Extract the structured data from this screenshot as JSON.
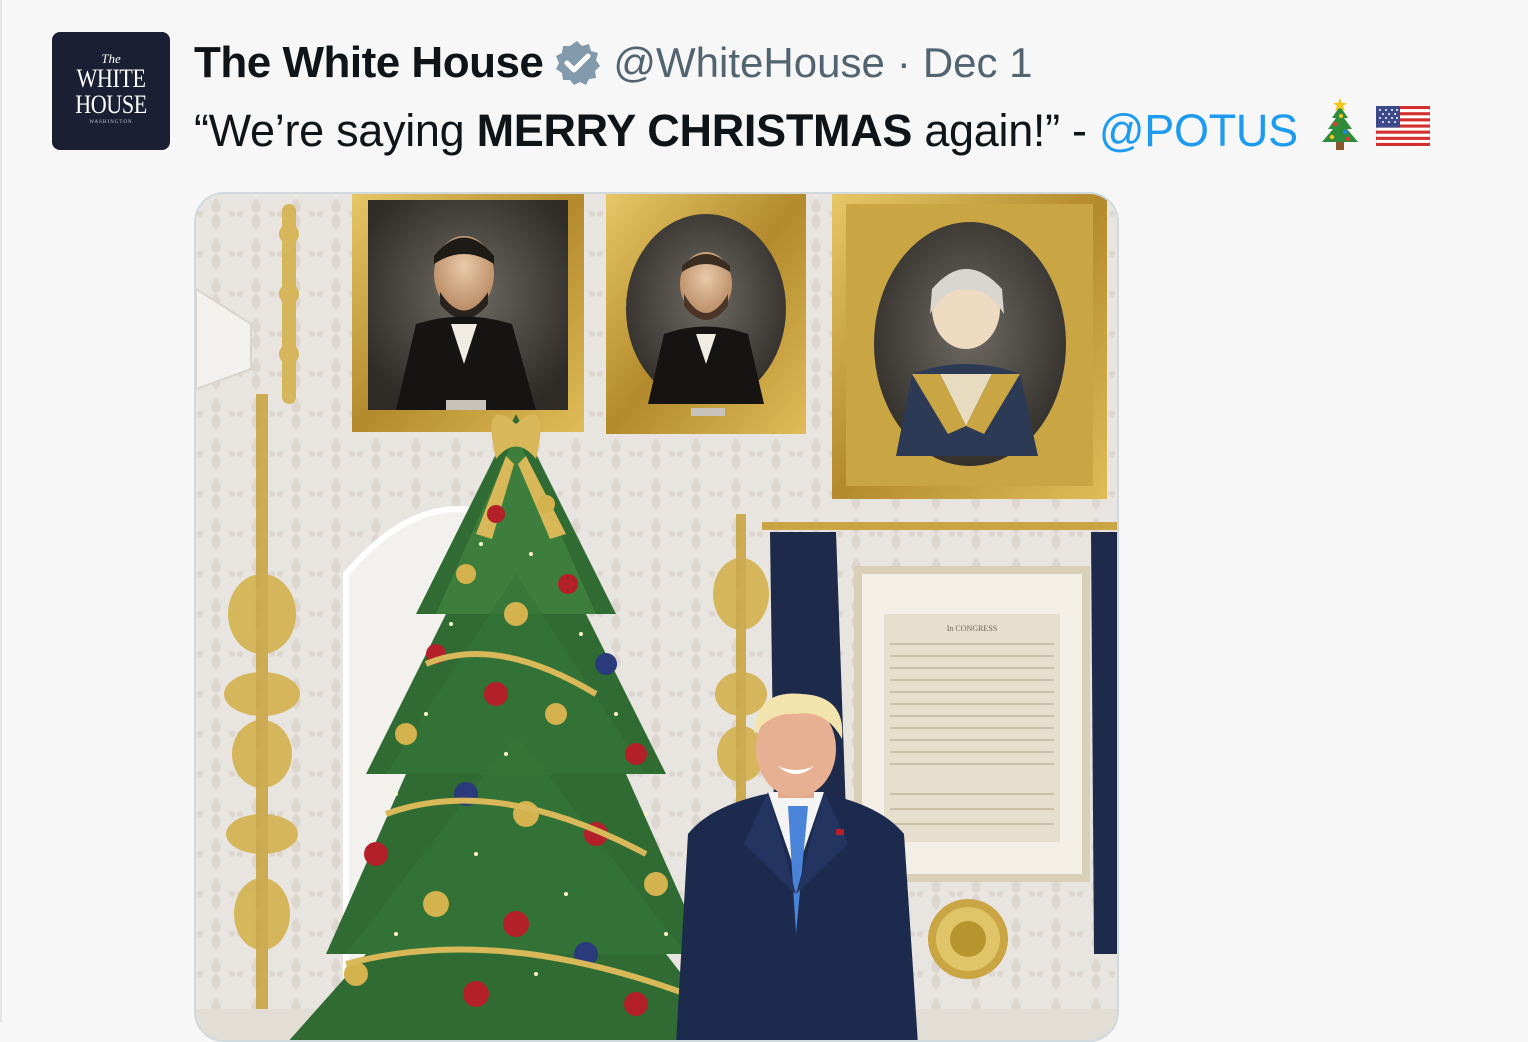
{
  "account": {
    "display_name": "The White House",
    "handle": "@WhiteHouse",
    "separator": "·",
    "date": "Dec 1",
    "verified_icon": "verified-badge-icon",
    "avatar": {
      "line1": "The",
      "line2": "WHITE",
      "line3": "HOUSE",
      "line4": "WASHINGTON"
    }
  },
  "tweet": {
    "text_before": "“We’re saying",
    "text_bold": "MERRY CHRISTMAS",
    "text_after": "again!” -",
    "mention": "@POTUS",
    "emoji_1": "christmas-tree-icon",
    "emoji_2": "us-flag-icon"
  },
  "media": {
    "type": "photo",
    "document_heading": "In CONGRESS"
  },
  "colors": {
    "accent": "#1d9bf0",
    "verified": "#829aab",
    "avatar_bg": "#1b1f33",
    "background": "#f7f7f7"
  }
}
